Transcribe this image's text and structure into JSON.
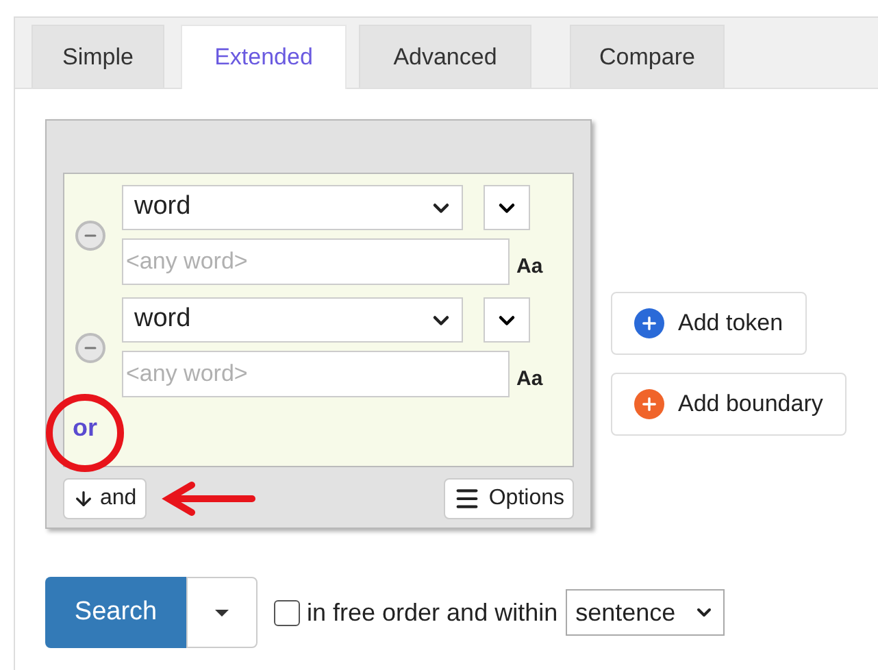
{
  "tabs": [
    {
      "label": "Simple",
      "selected": false
    },
    {
      "label": "Extended",
      "selected": true
    },
    {
      "label": "Advanced",
      "selected": false
    },
    {
      "label": "Compare",
      "selected": false
    }
  ],
  "query": {
    "tokens": [
      {
        "attribute": "word",
        "placeholder": "<any word>",
        "case_label": "Aa"
      },
      {
        "attribute": "word",
        "placeholder": "<any word>",
        "case_label": "Aa"
      }
    ],
    "or_label": "or",
    "and_label": "and",
    "options_label": "Options"
  },
  "side_buttons": [
    {
      "label": "Add token",
      "kind": "token"
    },
    {
      "label": "Add boundary",
      "kind": "boundary"
    }
  ],
  "search": {
    "label": "Search",
    "free_order": {
      "checked": false,
      "label": "in free order and within"
    },
    "within": "sentence"
  }
}
